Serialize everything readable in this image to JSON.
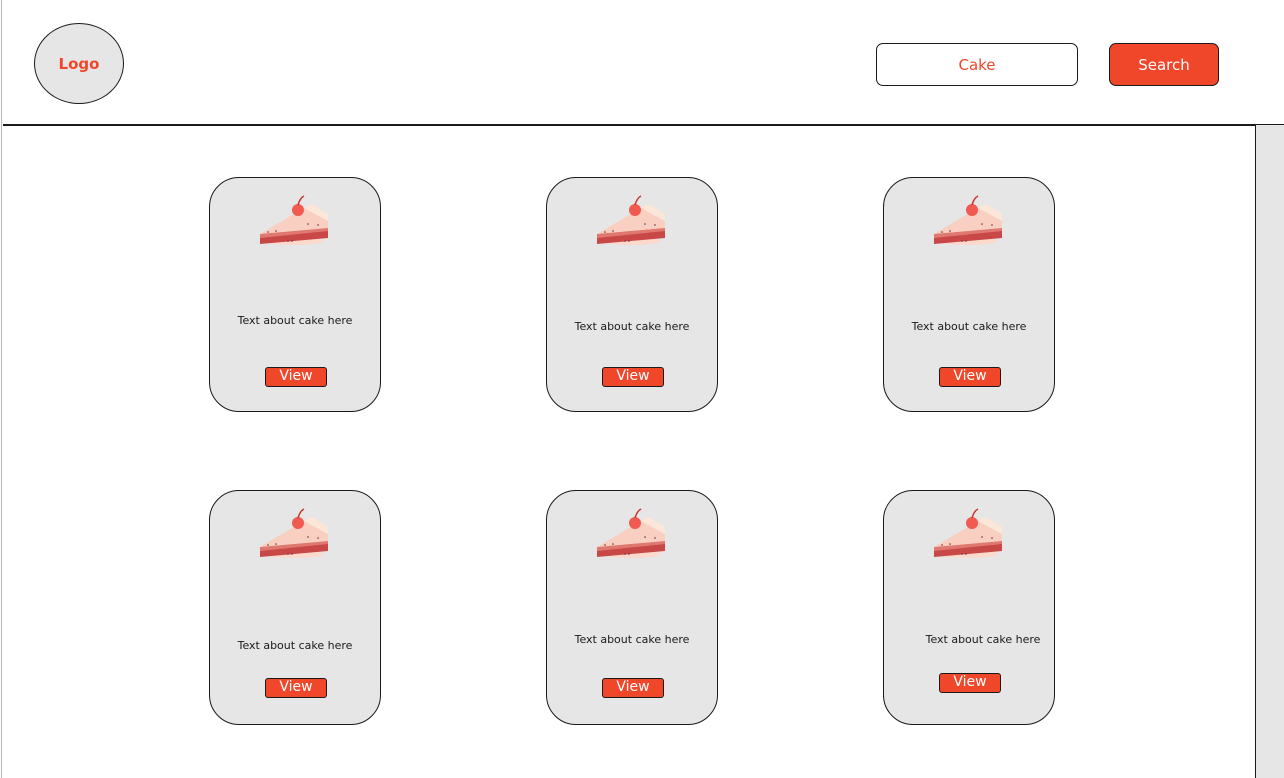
{
  "header": {
    "logo_label": "Logo",
    "search_value": "Cake",
    "search_button_label": "Search"
  },
  "cards": [
    {
      "text": "Text about cake here",
      "button_label": "View",
      "icon": "cake-slice-icon"
    },
    {
      "text": "Text about cake here",
      "button_label": "View",
      "icon": "cake-slice-icon"
    },
    {
      "text": "Text about cake here",
      "button_label": "View",
      "icon": "cake-slice-icon"
    },
    {
      "text": "Text about cake here",
      "button_label": "View",
      "icon": "cake-slice-icon"
    },
    {
      "text": "Text about cake here",
      "button_label": "View",
      "icon": "cake-slice-icon"
    },
    {
      "text": "Text about cake here",
      "button_label": "View",
      "icon": "cake-slice-icon"
    }
  ],
  "colors": {
    "accent": "#f0462a",
    "card_bg": "#e6e6e6",
    "outline": "#1a1a1a"
  }
}
